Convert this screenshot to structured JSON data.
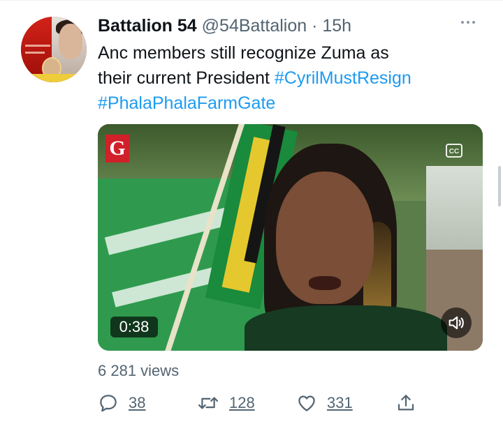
{
  "tweet": {
    "author_name": "Battalion 54",
    "author_handle": "@54Battalion",
    "separator": "·",
    "time": "15h",
    "text_line1": "Anc members still recognize Zuma as",
    "text_line2_plain": "their current President ",
    "hashtags": [
      "#CyrilMustResign",
      "#PhalaPhalaFarmGate"
    ]
  },
  "media": {
    "badge_letter": "G",
    "cc_label": "CC",
    "duration": "0:38"
  },
  "stats": {
    "views": "6 281 views"
  },
  "actions": {
    "replies": "38",
    "retweets": "128",
    "likes": "331"
  },
  "icons": {
    "reply": "reply-icon",
    "retweet": "retweet-icon",
    "like": "heart-icon",
    "share": "share-icon",
    "more": "more-icon",
    "volume": "volume-icon",
    "captions": "closed-captions-icon"
  },
  "colors": {
    "link": "#1d9bf0",
    "secondary_text": "#536471",
    "primary_text": "#0f1419"
  }
}
